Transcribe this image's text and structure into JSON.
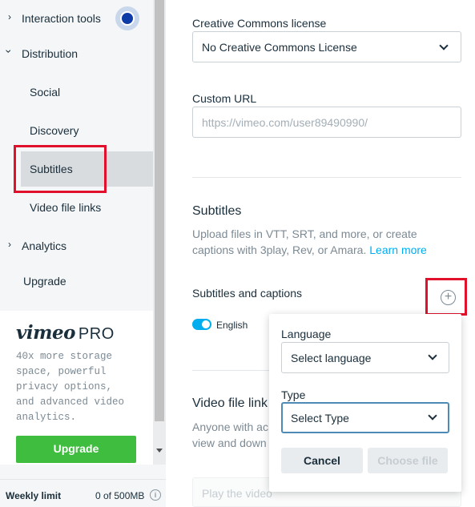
{
  "sidebar": {
    "items": [
      {
        "label": "Interaction tools",
        "chevron": "›"
      },
      {
        "label": "Distribution",
        "chevron": "⌄"
      },
      {
        "label": "Social"
      },
      {
        "label": "Discovery"
      },
      {
        "label": "Subtitles"
      },
      {
        "label": "Video file links"
      },
      {
        "label": "Analytics",
        "chevron": "›"
      },
      {
        "label": "Upgrade"
      }
    ],
    "active_item": "Subtitles",
    "promo": {
      "logo_text": "vimeo",
      "logo_suffix": "PRO",
      "text": "40x more storage space, powerful privacy options, and advanced video analytics.",
      "button_label": "Upgrade",
      "button_color": "#3ebd3e"
    },
    "weekly": {
      "label": "Weekly limit",
      "value": "0 of 500MB",
      "info_icon": "i"
    }
  },
  "main": {
    "cc_license": {
      "label": "Creative Commons license",
      "value": "No Creative Commons License"
    },
    "custom_url": {
      "label": "Custom URL",
      "placeholder": "https://vimeo.com/user89490990/"
    },
    "subtitles": {
      "heading": "Subtitles",
      "description": "Upload files in VTT, SRT, and more, or create captions with 3play, Rev, or Amara.",
      "link": "Learn more",
      "captions_label": "Subtitles and captions",
      "add_icon": "+",
      "track_label": "English"
    },
    "video_file_links": {
      "heading": "Video file link",
      "description_line1": "Anyone with ac",
      "description_line2": "view and down",
      "select_placeholder": "Play the video"
    }
  },
  "popup": {
    "language_label": "Language",
    "language_value": "Select language",
    "type_label": "Type",
    "type_value": "Select Type",
    "cancel_label": "Cancel",
    "choose_label": "Choose file"
  },
  "colors": {
    "accent": "#00adef",
    "highlight_box": "#e1112c",
    "indicator": "#0d3ba8"
  }
}
